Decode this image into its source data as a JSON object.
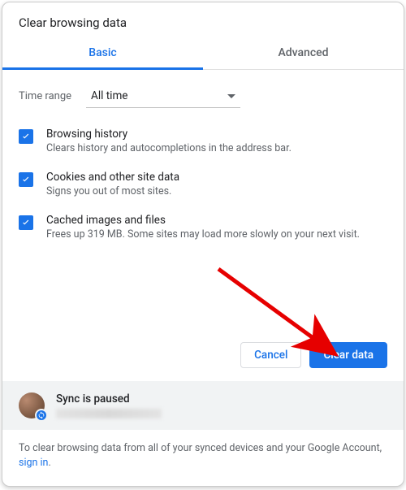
{
  "title": "Clear browsing data",
  "tabs": {
    "basic": "Basic",
    "advanced": "Advanced"
  },
  "time_range": {
    "label": "Time range",
    "value": "All time"
  },
  "options": [
    {
      "title": "Browsing history",
      "desc": "Clears history and autocompletions in the address bar."
    },
    {
      "title": "Cookies and other site data",
      "desc": "Signs you out of most sites."
    },
    {
      "title": "Cached images and files",
      "desc": "Frees up 319 MB. Some sites may load more slowly on your next visit."
    }
  ],
  "buttons": {
    "cancel": "Cancel",
    "clear": "Clear data"
  },
  "sync": {
    "title": "Sync is paused"
  },
  "footer": {
    "text": "To clear browsing data from all of your synced devices and your Google Account, ",
    "link": "sign in",
    "suffix": "."
  },
  "colors": {
    "accent": "#1a73e8"
  }
}
